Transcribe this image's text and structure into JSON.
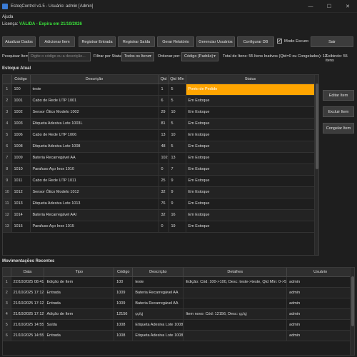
{
  "window": {
    "title": "EstoqControl v1.5 - Usuário: admin [Admin]"
  },
  "menu": {
    "help": "Ajuda"
  },
  "license": {
    "prefix": "Licença:",
    "status": "VÁLIDA - Expira em 21/10/2026"
  },
  "toolbar": {
    "refresh": "Atualizar Dados",
    "add_item": "Adicionar Item",
    "register_entry": "Registrar Entrada",
    "register_exit": "Registrar Saída",
    "report": "Gerar Relatório",
    "manage_users": "Gerenciar Usuários",
    "configure_db": "Configurar DB",
    "dark_mode": "Modo Escuro",
    "dark_mode_checked": true,
    "exit": "Sair"
  },
  "filters": {
    "search_label": "Pesquisar Item:",
    "search_placeholder": "Digite o código ou a descrição...",
    "status_label": "Filtrar por Status:",
    "status_value": "Todos os Itens",
    "order_label": "Ordenar por:",
    "order_value": "Código (Padrão)",
    "total_items": "Total de Itens: 55",
    "inactive_items": "Itens Inativos (Qtd=0 ou Congelados): 12",
    "showing": "Exibindo: 55 itens"
  },
  "stock": {
    "title": "Estoque Atual",
    "columns": [
      "Código",
      "Descrição",
      "Qtd",
      "Qtd Mín",
      "Status"
    ],
    "rows": [
      [
        "1",
        "100",
        "teste",
        "1",
        "5",
        "Ponto de Pedido"
      ],
      [
        "2",
        "1001",
        "Cabo de Rede UTP 1001",
        "6",
        "5",
        "Em Estoque"
      ],
      [
        "3",
        "1002",
        "Sensor Ótico Modelo 1002",
        "29",
        "10",
        "Em Estoque"
      ],
      [
        "4",
        "1003",
        "Etiqueta Adesiva Lote 1003L",
        "81",
        "5",
        "Em Estoque"
      ],
      [
        "5",
        "1006",
        "Cabo de Rede UTP 1006",
        "13",
        "10",
        "Em Estoque"
      ],
      [
        "6",
        "1008",
        "Etiqueta Adesiva Lote 1008",
        "48",
        "5",
        "Em Estoque"
      ],
      [
        "7",
        "1009",
        "Bateria Recarregável AA",
        "102",
        "13",
        "Em Estoque"
      ],
      [
        "8",
        "1010",
        "Parafuso Aço Inox 1010",
        "0",
        "7",
        "Em Estoque"
      ],
      [
        "9",
        "1011",
        "Cabo de Rede UTP 1011",
        "25",
        "9",
        "Em Estoque"
      ],
      [
        "10",
        "1012",
        "Sensor Ótico Modelo 1012",
        "32",
        "9",
        "Em Estoque"
      ],
      [
        "11",
        "1013",
        "Etiqueta Adesiva Lote 1013",
        "76",
        "9",
        "Em Estoque"
      ],
      [
        "12",
        "1014",
        "Bateria Recarregável AAI",
        "32",
        "16",
        "Em Estoque"
      ],
      [
        "13",
        "1015",
        "Parafuso Aço Inox 1015",
        "0",
        "19",
        "Em Estoque"
      ]
    ]
  },
  "side_actions": {
    "edit": "Editar Item",
    "delete": "Excluir Item",
    "freeze": "Congelar Item"
  },
  "movements": {
    "title": "Movimentações Recentes",
    "columns": [
      "Data",
      "Tipo",
      "Código",
      "Descrição",
      "Detalhes",
      "Usuário"
    ],
    "rows": [
      [
        "1",
        "22/10/2025 08:41",
        "Edição de Item",
        "100",
        "teste",
        "Edição: Cód: 100->100, Desc: teste->teste, Qtd Mín: 0->5",
        "admin"
      ],
      [
        "2",
        "21/10/2025 17:12",
        "Entrada",
        "1009",
        "Bateria Recarregável AA",
        "",
        "admin"
      ],
      [
        "3",
        "21/10/2025 17:12",
        "Entrada",
        "1009",
        "Bateria Recarregável AA",
        "",
        "admin"
      ],
      [
        "4",
        "21/10/2025 17:12",
        "Adição de Item",
        "12156",
        "çç/çj",
        "Item novo: Cód: 12156, Desc: çç/çj",
        "admin"
      ],
      [
        "5",
        "21/10/2025 14:55",
        "Saída",
        "1008",
        "Etiqueta Adesiva Lote 1008",
        "",
        "admin"
      ],
      [
        "6",
        "21/10/2025 14:55",
        "Entrada",
        "1008",
        "Etiqueta Adesiva Lote 1008",
        "",
        "admin"
      ]
    ]
  },
  "colors": {
    "warning": "#ffa500",
    "license_valid": "#3adf3a"
  }
}
